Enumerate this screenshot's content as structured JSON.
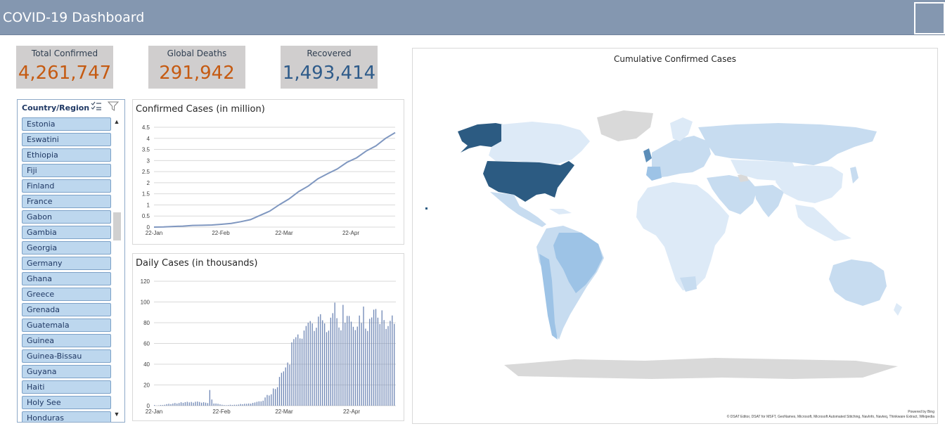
{
  "app": {
    "title": "COVID-19 Dashboard"
  },
  "kpis": [
    {
      "label": "Total Confirmed",
      "value": "4,261,747",
      "color": "#c55a11"
    },
    {
      "label": "Global Deaths",
      "value": "291,942",
      "color": "#c55a11"
    },
    {
      "label": "Recovered",
      "value": "1,493,414",
      "color": "#2e5b8a"
    }
  ],
  "slicer": {
    "header": "Country/Region",
    "multi_select_icon": "multi-select-icon",
    "clear_filter_icon": "clear-filter-icon",
    "items": [
      "Estonia",
      "Eswatini",
      "Ethiopia",
      "Fiji",
      "Finland",
      "France",
      "Gabon",
      "Gambia",
      "Georgia",
      "Germany",
      "Ghana",
      "Greece",
      "Grenada",
      "Guatemala",
      "Guinea",
      "Guinea-Bissau",
      "Guyana",
      "Haiti",
      "Holy See",
      "Honduras"
    ]
  },
  "chart_data": [
    {
      "type": "line",
      "title": "Confirmed Cases (in million)",
      "xlabel": "",
      "ylabel": "",
      "x_tick_labels": [
        "22-Jan",
        "22-Feb",
        "22-Mar",
        "22-Apr"
      ],
      "y_ticks": [
        0,
        0.5,
        1,
        1.5,
        2,
        2.5,
        3,
        3.5,
        4,
        4.5
      ],
      "ylim": [
        0,
        4.5
      ],
      "grid": true,
      "x": [
        "22-Jan",
        "29-Jan",
        "5-Feb",
        "12-Feb",
        "19-Feb",
        "26-Feb",
        "4-Mar",
        "11-Mar",
        "15-Mar",
        "19-Mar",
        "22-Mar",
        "26-Mar",
        "29-Mar",
        "2-Apr",
        "5-Apr",
        "9-Apr",
        "12-Apr",
        "16-Apr",
        "19-Apr",
        "22-Apr",
        "26-Apr",
        "29-Apr",
        "3-May",
        "6-May",
        "10-May",
        "13-May"
      ],
      "values": [
        0.0006,
        0.006,
        0.028,
        0.045,
        0.076,
        0.082,
        0.095,
        0.126,
        0.168,
        0.243,
        0.337,
        0.53,
        0.72,
        1.01,
        1.27,
        1.6,
        1.85,
        2.18,
        2.41,
        2.62,
        2.92,
        3.12,
        3.43,
        3.66,
        4.0,
        4.26
      ],
      "series_color": "#7f97c0"
    },
    {
      "type": "bar",
      "title": "Daily Cases (in thousands)",
      "xlabel": "",
      "ylabel": "",
      "x_tick_labels": [
        "22-Jan",
        "22-Feb",
        "22-Mar",
        "22-Apr"
      ],
      "y_ticks": [
        0,
        20,
        40,
        60,
        80,
        100,
        120
      ],
      "ylim": [
        0,
        120
      ],
      "grid": true,
      "values": [
        0.6,
        0.1,
        0.3,
        0.6,
        0.6,
        0.9,
        1.5,
        1.8,
        1.5,
        2.1,
        2.6,
        2.1,
        2.6,
        3.3,
        2.8,
        3.4,
        3.7,
        3.2,
        3.6,
        2.9,
        3.8,
        4.0,
        3.6,
        2.9,
        3.3,
        2.9,
        2.5,
        15.1,
        6.0,
        2.1,
        2.1,
        1.8,
        1.3,
        0.9,
        0.6,
        0.5,
        0.6,
        0.9,
        0.7,
        0.9,
        0.9,
        1.1,
        1.6,
        1.4,
        1.8,
        1.8,
        2.1,
        2.0,
        2.7,
        3.1,
        3.7,
        4.2,
        4.2,
        4.8,
        7.9,
        10.4,
        9.8,
        11.0,
        16.6,
        16.1,
        17.8,
        27.7,
        31.7,
        33.1,
        36.9,
        41.6,
        39.6,
        61.1,
        64.2,
        66.0,
        68.7,
        64.9,
        64.6,
        72.5,
        76.9,
        80.0,
        81.6,
        79.3,
        72.1,
        75.2,
        85.9,
        88.2,
        82.4,
        79.3,
        70.9,
        72.4,
        84.9,
        89.2,
        99.4,
        84.4,
        75.4,
        72.7,
        97.2,
        80.0,
        86.6,
        86.5,
        81.0,
        76.1,
        72.9,
        76.3,
        86.9,
        79.8,
        95.6,
        74.3,
        72.1,
        83.7,
        85.1,
        92.6,
        93.2,
        84.9,
        78.8,
        91.9,
        82.6,
        74.0,
        76.8,
        81.8,
        87.0,
        78.9
      ],
      "series_color": "#6f87b5"
    }
  ],
  "map": {
    "title": "Cumulative Confirmed Cases",
    "credit_line1": "Powered by Bing",
    "credit_line2": "© DSAT Editor, DSAT for MSFT, GeoNames, Microsoft, Microsoft Automated Stitching, NavInfo, Navteq, Thinkware Extract, Wikipedia",
    "colors": {
      "highest": "#2c5b82",
      "high": "#5b8db8",
      "medium": "#9dc3e6",
      "low": "#c7dcf0",
      "lowest": "#ddeaf7",
      "no_data": "#d9d9d9"
    }
  }
}
